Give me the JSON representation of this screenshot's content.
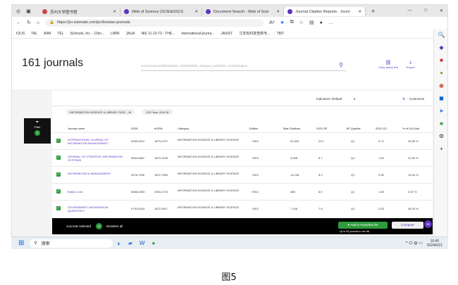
{
  "tabs": [
    {
      "title": "苏州大学图书馆"
    },
    {
      "title": "Web of Science (SCIE&SSCI)"
    },
    {
      "title": "Document Search - Web of Scie"
    },
    {
      "title": "Journal Citation Reports - Journ"
    }
  ],
  "new_tab": "+",
  "window_controls": [
    "—",
    "□",
    "✕"
  ],
  "url": "https://jcr.clarivate.com/jcr/browse-journals",
  "bookmarks": [
    "IOUS",
    "TAL",
    "AIIM",
    "TEL",
    "iSchools, Inc. - Chin...",
    "LIBRI",
    "JAUA",
    "NIE 11-13-73 - THE...",
    "International journa...",
    "JASIST",
    "江苏省科技查新专...",
    "TBIT"
  ],
  "page": {
    "title": "161 journals",
    "search_placeholder": "Journal name/abbreviation, ISSN/eISSN, category, publisher, country/region",
    "copy_query": "Copy query link",
    "export": "Export",
    "indicators_label": "Indicators: Default",
    "customize": "Customize",
    "chips": [
      "INFORMATION SCIENCE & LIBRARY SCIE...",
      "JCR Year: 2024"
    ],
    "filter_label": "Filter",
    "filter_count": "2"
  },
  "columns": [
    "Journal name",
    "ISSN",
    "eISSN",
    "Category",
    "Edition",
    "Total Citations",
    "2023 JIF",
    "JIF Quartile",
    "2023 JCI",
    "% of OA Gold"
  ],
  "rows": [
    [
      "INTERNATIONAL JOURNAL OF INFORMATION MANAGEMENT",
      "0268-4012",
      "1873-4707",
      "INFORMATION SCIENCE & LIBRARY SCIENCE",
      "SSCI",
      "20,325",
      "20.1",
      "Q1",
      "5.74",
      "34.85 %"
    ],
    [
      "JOURNAL OF STRATEGIC INFORMATION SYSTEMS",
      "0963-8687",
      "1873-1198",
      "INFORMATION SCIENCE & LIBRARY SCIENCE",
      "SSCI",
      "3,838",
      "8.7",
      "Q1",
      "1.83",
      "37.84 %"
    ],
    [
      "INFORMATION & MANAGEMENT",
      "0378-7206",
      "1872-7530",
      "INFORMATION SCIENCE & LIBRARY SCIENCE",
      "SSCI",
      "13,138",
      "8.2",
      "Q1",
      "2.55",
      "13.26 %"
    ],
    [
      "Bottom Line",
      "0888-045X",
      "2054-1724",
      "INFORMATION SCIENCE & LIBRARY SCIENCE",
      "ESCI",
      "488",
      "8.0",
      "Q1",
      "1.65",
      "3.57 %"
    ],
    [
      "GOVERNMENT INFORMATION QUARTERLY",
      "0740-624X",
      "1872-9517",
      "INFORMATION SCIENCE & LIBRARY SCIENCE",
      "SSCI",
      "7,198",
      "7.8",
      "Q1",
      "2.63",
      "38.93 %"
    ]
  ],
  "bottom": {
    "selected_label": "Journals selected",
    "selected_count": "0",
    "deselect": "Deselect all",
    "add_favorites": "Add to Favorites list",
    "favorites_hint": "Up to 50 journals in one list",
    "compare": "Compare",
    "compare_count": "15"
  },
  "taskbar": {
    "search": "搜索",
    "time": "10:45",
    "date": "2024/6/21"
  },
  "figure_caption": "图5"
}
